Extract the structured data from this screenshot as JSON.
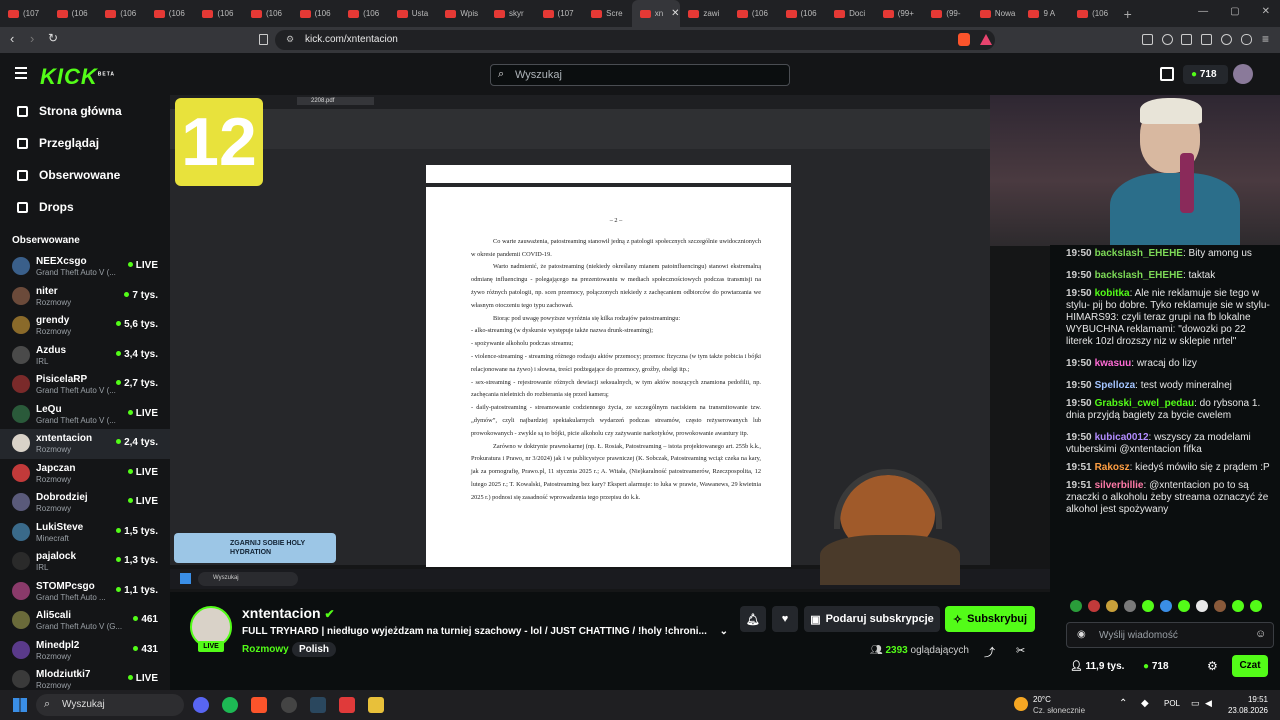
{
  "browser": {
    "tabs": [
      {
        "label": "(107"
      },
      {
        "label": "(106"
      },
      {
        "label": "(106"
      },
      {
        "label": "(106"
      },
      {
        "label": "(106"
      },
      {
        "label": "(106"
      },
      {
        "label": "(106"
      },
      {
        "label": "(106"
      },
      {
        "label": "Usta"
      },
      {
        "label": "Wpis"
      },
      {
        "label": "skyr"
      },
      {
        "label": "(107"
      },
      {
        "label": "Scre"
      },
      {
        "label": "xn",
        "active": true
      },
      {
        "label": "zawi"
      },
      {
        "label": "(106"
      },
      {
        "label": "(106"
      },
      {
        "label": "Doci"
      },
      {
        "label": "(99+"
      },
      {
        "label": "(99-"
      },
      {
        "label": "Nowa"
      },
      {
        "label": "9 A"
      },
      {
        "label": "(106"
      }
    ],
    "url": "kick.com/xntentacion"
  },
  "kick": {
    "logo": "KICK",
    "logo_sup": "BETA",
    "search_placeholder": "Wyszukaj",
    "points": "718"
  },
  "sidebar": {
    "nav": [
      {
        "label": "Strona główna",
        "icon": "home-icon"
      },
      {
        "label": "Przeglądaj",
        "icon": "browse-icon"
      },
      {
        "label": "Obserwowane",
        "icon": "heart-icon"
      },
      {
        "label": "Drops",
        "icon": "drops-icon"
      }
    ],
    "following_header": "Obserwowane",
    "channels": [
      {
        "name": "NEEXcsgo",
        "category": "Grand Theft Auto V (...",
        "viewers": "LIVE",
        "color": "#3a5f8a"
      },
      {
        "name": "niter",
        "category": "Rozmowy",
        "viewers": "7 tys.",
        "color": "#6b4a3a"
      },
      {
        "name": "grendy",
        "category": "Rozmowy",
        "viewers": "5,6 tys.",
        "color": "#8a6a2a"
      },
      {
        "name": "Azdus",
        "category": "IRL",
        "viewers": "3,4 tys.",
        "color": "#4a4a4a"
      },
      {
        "name": "PisicelaRP",
        "category": "Grand Theft Auto V (...",
        "viewers": "2,7 tys.",
        "color": "#7a2a2a"
      },
      {
        "name": "LeQu",
        "category": "Grand Theft Auto V (...",
        "viewers": "LIVE",
        "color": "#2a5a3a"
      },
      {
        "name": "xntentacion",
        "category": "Rozmowy",
        "viewers": "2,4 tys.",
        "color": "#d9d2c8",
        "active": true
      },
      {
        "name": "Japczan",
        "category": "Rozmowy",
        "viewers": "LIVE",
        "color": "#c23a3a"
      },
      {
        "name": "Dobrodziej",
        "category": "Rozmowy",
        "viewers": "LIVE",
        "color": "#5a5a7a"
      },
      {
        "name": "LukiSteve",
        "category": "Minecraft",
        "viewers": "1,5 tys.",
        "color": "#3a6a8a"
      },
      {
        "name": "pajalock",
        "category": "IRL",
        "viewers": "1,3 tys.",
        "color": "#2a2a2a"
      },
      {
        "name": "STOMPcsgo",
        "category": "Grand Theft Auto ...",
        "viewers": "1,1 tys.",
        "color": "#8a3a6a"
      },
      {
        "name": "Ali5cali",
        "category": "Grand Theft Auto V (G...",
        "viewers": "461",
        "color": "#6a6a3a"
      },
      {
        "name": "Minedpl2",
        "category": "Rozmowy",
        "viewers": "431",
        "color": "#5a3a8a"
      },
      {
        "name": "Mlodziutki7",
        "category": "Rozmowy",
        "viewers": "LIVE",
        "color": "#3a3a3a"
      }
    ]
  },
  "video": {
    "badge": "12",
    "pdf_title": "2208.pdf",
    "page_number": "– 2 –",
    "paragraphs": [
      "Co warte zauważenia, patostreaming stanowił jedną z patologii społecznych szczególnie uwidocznionych w okresie pandemii COVID-19.",
      "Warto nadmienić, że patostreaming (niekiedy określany mianem patoinfluencingu) stanowi ekstremalną odmianę influencingu - polegającego na prezentowaniu w mediach społecznościowych podczas transmisji na żywo różnych patologii, np. scen przemocy, połączonych niekiedy z zachęcaniem odbiorców do powtarzania we własnym otoczeniu tego typu zachowań.",
      "Biorąc pod uwagę powyższe wyróżnia się kilka rodzajów patostreamingu:",
      "- alko-streaming (w dyskursie występuje także nazwa drunk-streaming);",
      "- spożywanie alkoholu podczas streamu;",
      "- violence-streaming - streaming różnego rodzaju aktów przemocy; przemoc fizyczna (w tym także pobicia i bójki relacjonowane na żywo) i słowna, treści podżegające do przemocy, groźby, obelgi itp.;",
      "- sex-streaming - rejestrowanie różnych dewiacji seksualnych, w tym aktów noszących znamiona pedofilii, np. zachęcania nieletnich do rozbierania się przed kamerą;",
      "- daily-patostreaming - streamowanie codziennego życia, ze szczególnym naciskiem na transmitowanie tzw. „dymów”, czyli najbardziej spektakularnych wydarzeń podczas streamów, często reżyserowanych lub prowokowanych - zwykle są to bójki, picie alkoholu czy zażywanie narkotyków, prowokowanie awantury itp.",
      "Zarówno w doktrynie prawnokarnej (np. Ł. Rosiak, Patostreaming – istota projektowanego art. 255b k.k., Prokuratura i Prawo, nr 3/2024) jak i w publicystyce prawniczej (K. Sobczak, Patostreaming wciąż czeka na kary, jak za pornografię, Prawo.pl, 11 stycznia 2025 r.; A. Witała, (Nie)karalność patostreamerów, Rzeczpospolita, 12 lutego 2025 r.; T. Kowalski, Patostreaming bez kary? Ekspert alarmuje: to luka w prawie, Wawanews, 29 kwietnia 2025 r.) podnosi się zasadność wprowadzenia tego przepisu do k.k."
    ],
    "promo": "ZGARNIJ SOBIE HOLY HYDRATION",
    "inner_search": "Wyszukaj"
  },
  "chat": {
    "messages": [
      {
        "time": "19:50",
        "user": "backslash_EHEHE",
        "color": "#7dd957",
        "text": "Bity among us"
      },
      {
        "time": "19:50",
        "user": "backslash_EHEHE",
        "color": "#7dd957",
        "text": "taktak"
      },
      {
        "time": "19:50",
        "user": "kobitka",
        "color": "#53fc18",
        "text": "Ale nie reklamuje sie tego w stylu- pij bo dobre. Tyko reklamuje sie w stylu- HIMARS93: czyli teraz grupi na fb lokalne WYBUCHNA reklamami: \"dowozki po 22 literek 10zl drozszy niz w sklepie nrtel\""
      },
      {
        "time": "19:50",
        "user": "kwasuu",
        "color": "#ff6bd5",
        "text": "wracaj do lizy"
      },
      {
        "time": "19:50",
        "user": "Spelloza",
        "color": "#a3c4ff",
        "text": "test wody mineralnej"
      },
      {
        "time": "19:50",
        "user": "Grabski_cwel_pedau",
        "color": "#53fc18",
        "text": "do rybsona 1. dnia przyjdą bagiety za bycie cwelem"
      },
      {
        "time": "19:50",
        "user": "kubica0012",
        "color": "#b28cff",
        "text": "wszyscy za modelami vtuberskimi @xntentacion fifka"
      },
      {
        "time": "19:51",
        "user": "Rakosz",
        "color": "#ff9f43",
        "text": "kiedyś mówiło się z prądem :P"
      },
      {
        "time": "19:51",
        "user": "silverbillie",
        "color": "#ff7aa8",
        "text": "@xntentacion po to są znaczki o alkoholu żeby streama oznaczyć że alkohol jest spożywany"
      }
    ],
    "input_placeholder": "Wyślij wiadomość",
    "followers": "11,9 tys.",
    "points": "718",
    "send_label": "Czat"
  },
  "channel": {
    "name": "xntentacion",
    "live_label": "LIVE",
    "title": "FULL TRYHARD | niedługo wyjeżdzam na turniej szachowy - lol / JUST CHATTING / !holy !chroni...",
    "category": "Rozmowy",
    "tag": "Polish",
    "gift_label": "Podaruj subskrypcje",
    "subscribe_label": "Subskrybuj",
    "viewers": "2393",
    "viewers_suffix": "oglądających"
  },
  "taskbar": {
    "search": "Wyszukaj",
    "weather_temp": "20°C",
    "weather_desc": "Cz. słonecznie",
    "lang": "POL",
    "time": "19:51",
    "date": "23.08.2026"
  }
}
